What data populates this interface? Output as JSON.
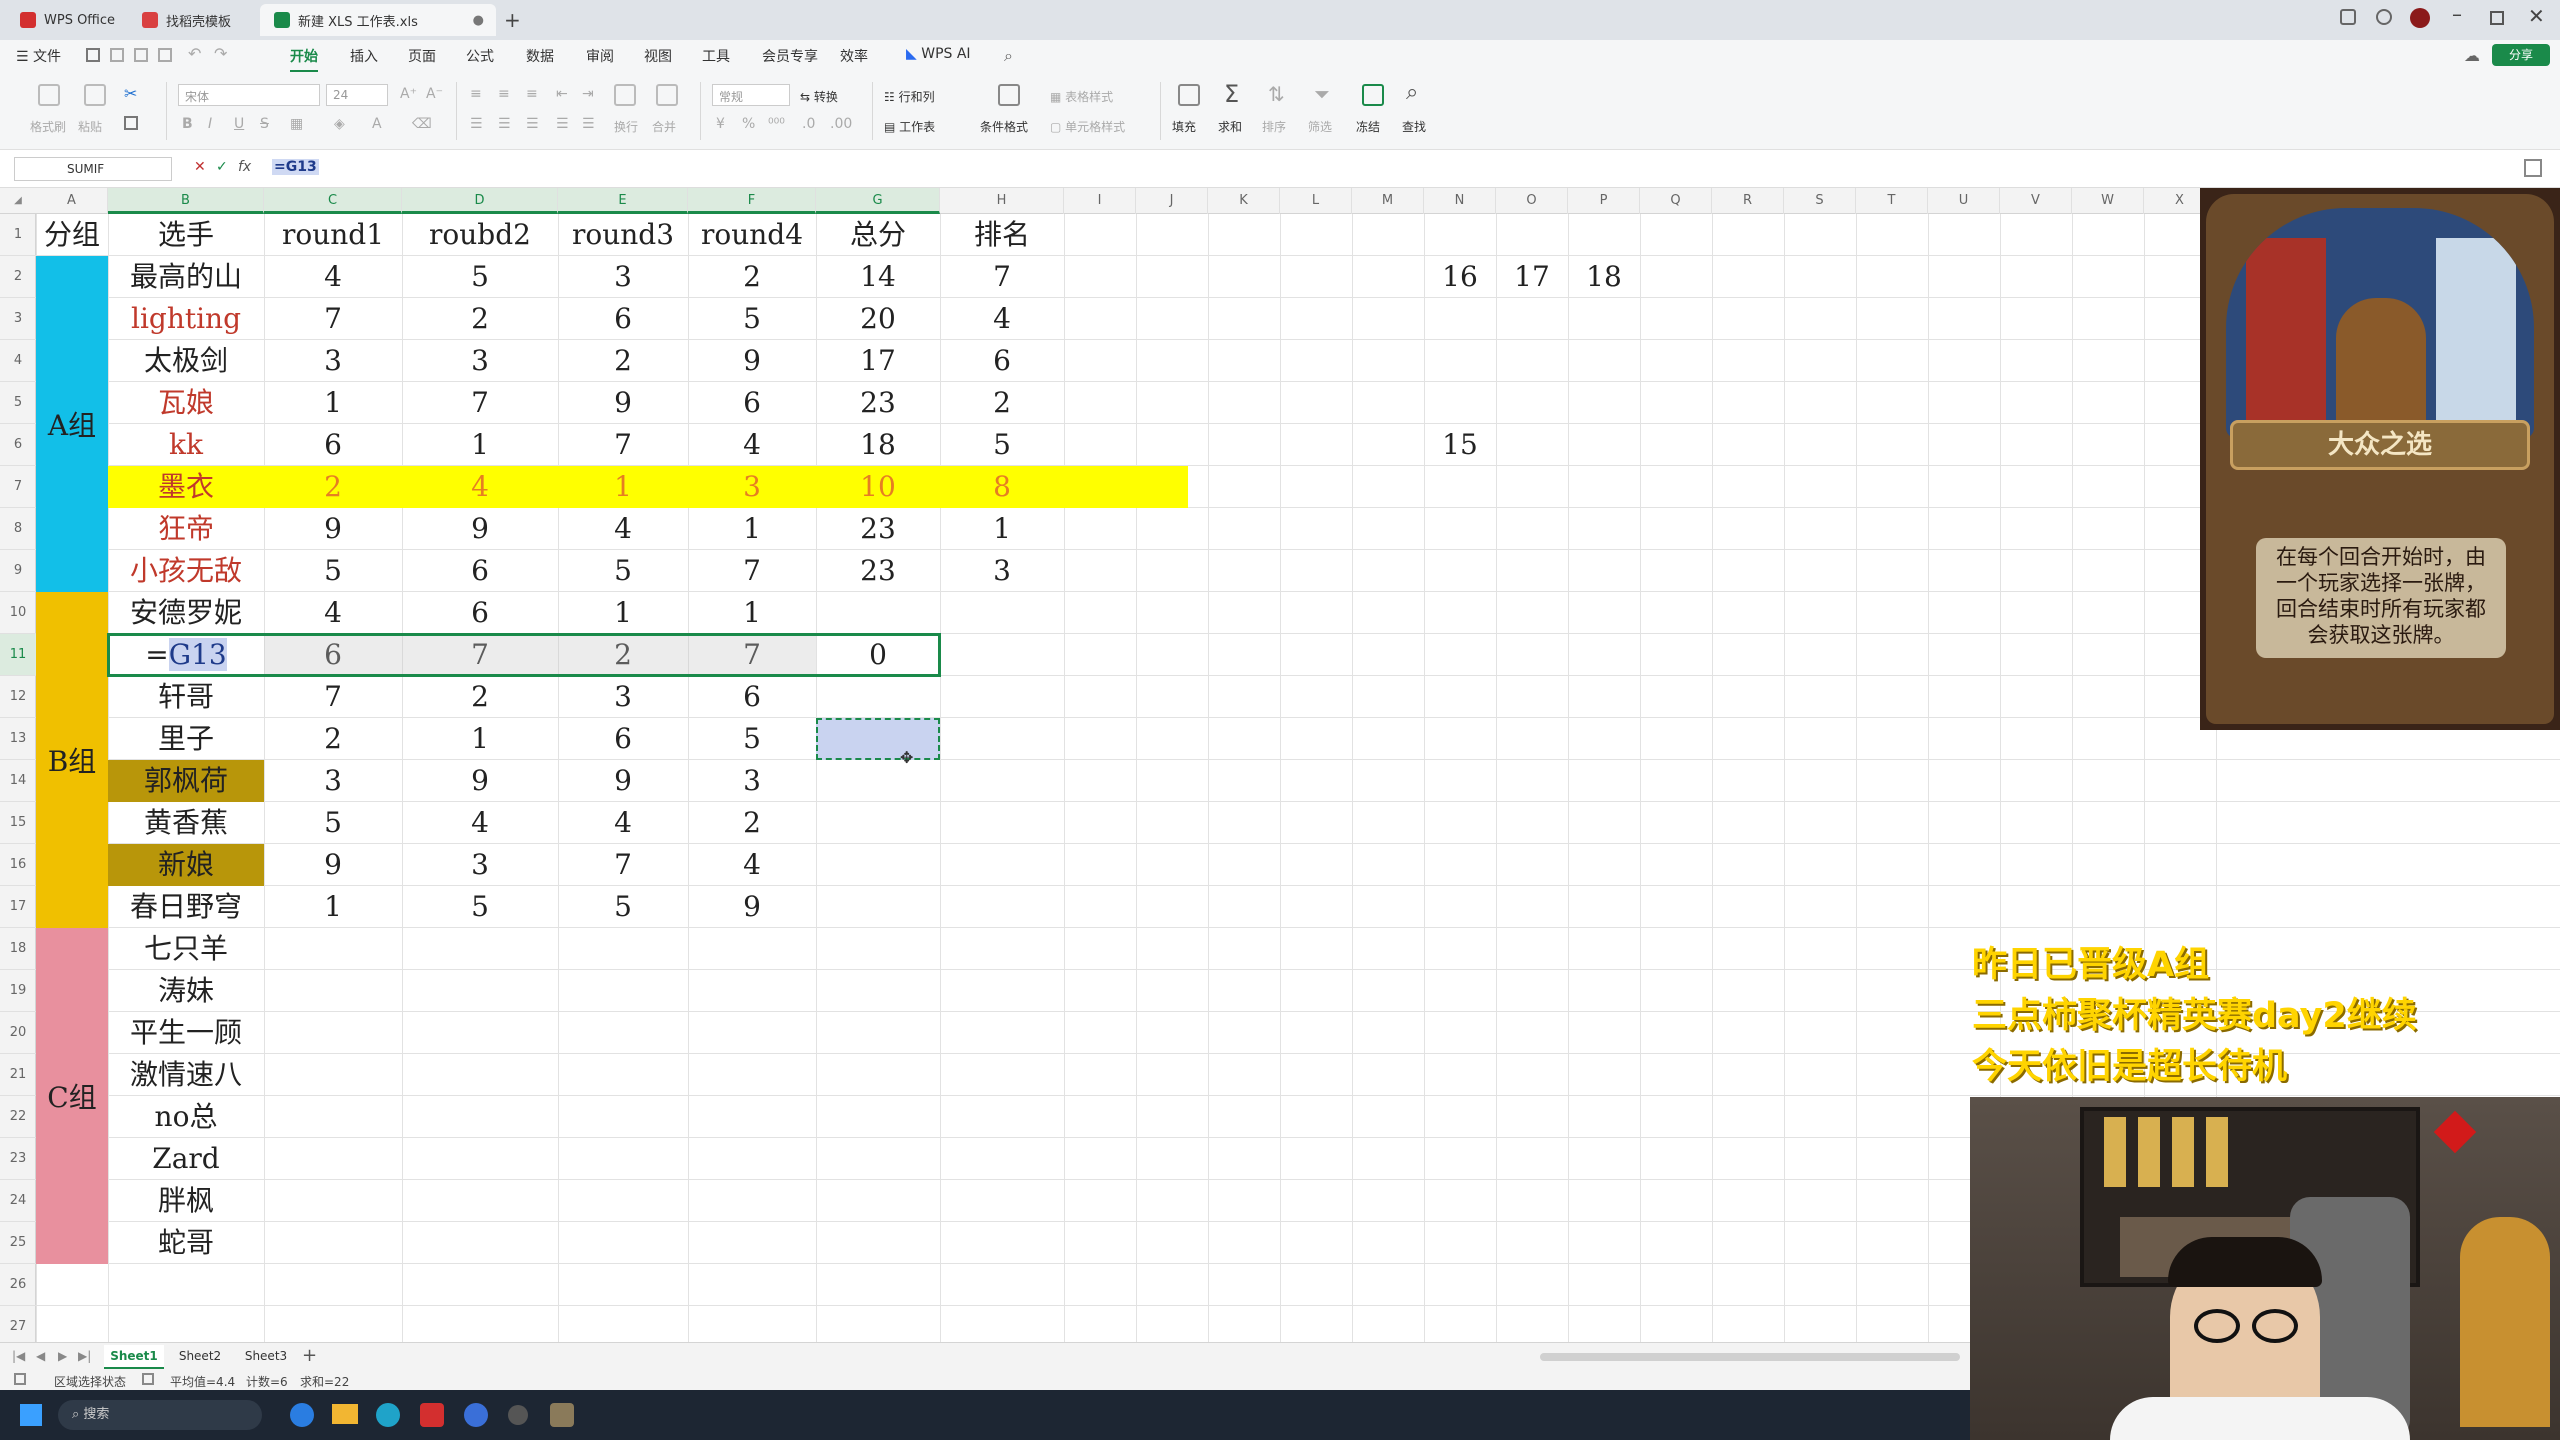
{
  "titlebar": {
    "tabs": [
      {
        "label": "WPS Office"
      },
      {
        "label": "找稻壳模板"
      },
      {
        "label": "新建 XLS 工作表.xls"
      }
    ]
  },
  "menubar": {
    "file": "文件",
    "items": [
      "开始",
      "插入",
      "页面",
      "公式",
      "数据",
      "审阅",
      "视图",
      "工具",
      "会员专享",
      "效率"
    ],
    "wps_ai": "WPS AI",
    "share": "分享"
  },
  "ribbon": {
    "format_painter": "格式刷",
    "paste": "粘贴",
    "font_name": "宋体",
    "font_size": "24",
    "number_format": "常规",
    "convert": "转换",
    "rows_cols": "行和列",
    "table_style": "表格样式",
    "worksheet": "工作表",
    "cond_format": "条件格式",
    "cell_style": "单元格样式",
    "wrap": "换行",
    "merge": "合并",
    "fill": "填充",
    "sum": "求和",
    "sort": "排序",
    "filter": "筛选",
    "freeze": "冻结",
    "find": "查找"
  },
  "formulabar": {
    "namebox": "SUMIF",
    "cancel": "✕",
    "confirm": "✓",
    "fx": "fx",
    "formula": "=G13"
  },
  "columns": [
    "A",
    "B",
    "C",
    "D",
    "E",
    "F",
    "G",
    "H",
    "I",
    "J",
    "K",
    "L",
    "M",
    "N",
    "O",
    "P",
    "Q",
    "R",
    "S",
    "T",
    "U",
    "V",
    "W",
    "X"
  ],
  "rows": [
    "1",
    "2",
    "3",
    "4",
    "5",
    "6",
    "7",
    "8",
    "9",
    "10",
    "11",
    "12",
    "13",
    "14",
    "15",
    "16",
    "17",
    "18",
    "19",
    "20",
    "21",
    "22",
    "23",
    "24",
    "25",
    "26",
    "27"
  ],
  "header_row": [
    "分组",
    "选手",
    "round1",
    "roubd2",
    "round3",
    "round4",
    "总分",
    "排名"
  ],
  "groups": [
    {
      "label": "A组",
      "color": "#12bfe8"
    },
    {
      "label": "B组",
      "color": "#f0c000"
    },
    {
      "label": "C组",
      "color": "#e8909e"
    }
  ],
  "players": [
    {
      "name": "最高的山",
      "r1": "4",
      "r2": "5",
      "r3": "3",
      "r4": "2",
      "total": "14",
      "rank": "7"
    },
    {
      "name": "lighting",
      "r1": "7",
      "r2": "2",
      "r3": "6",
      "r4": "5",
      "total": "20",
      "rank": "4"
    },
    {
      "name": "太极剑",
      "r1": "3",
      "r2": "3",
      "r3": "2",
      "r4": "9",
      "total": "17",
      "rank": "6"
    },
    {
      "name": "瓦娘",
      "r1": "1",
      "r2": "7",
      "r3": "9",
      "r4": "6",
      "total": "23",
      "rank": "2"
    },
    {
      "name": "kk",
      "r1": "6",
      "r2": "1",
      "r3": "7",
      "r4": "4",
      "total": "18",
      "rank": "5"
    },
    {
      "name": "墨衣",
      "r1": "2",
      "r2": "4",
      "r3": "1",
      "r4": "3",
      "total": "10",
      "rank": "8"
    },
    {
      "name": "狂帝",
      "r1": "9",
      "r2": "9",
      "r3": "4",
      "r4": "1",
      "total": "23",
      "rank": "1"
    },
    {
      "name": "小孩无敌",
      "r1": "5",
      "r2": "6",
      "r3": "5",
      "r4": "7",
      "total": "23",
      "rank": "3"
    },
    {
      "name": "安德罗妮",
      "r1": "4",
      "r2": "6",
      "r3": "1",
      "r4": "1",
      "total": "",
      "rank": ""
    },
    {
      "name": "=G13",
      "r1": "6",
      "r2": "7",
      "r3": "2",
      "r4": "7",
      "total": "0",
      "rank": ""
    },
    {
      "name": "轩哥",
      "r1": "7",
      "r2": "2",
      "r3": "3",
      "r4": "6",
      "total": "",
      "rank": ""
    },
    {
      "name": "里子",
      "r1": "2",
      "r2": "1",
      "r3": "6",
      "r4": "5",
      "total": "",
      "rank": ""
    },
    {
      "name": "郭枫荷",
      "r1": "3",
      "r2": "9",
      "r3": "9",
      "r4": "3",
      "total": "",
      "rank": ""
    },
    {
      "name": "黄香蕉",
      "r1": "5",
      "r2": "4",
      "r3": "4",
      "r4": "2",
      "total": "",
      "rank": ""
    },
    {
      "name": "新娘",
      "r1": "9",
      "r2": "3",
      "r3": "7",
      "r4": "4",
      "total": "",
      "rank": ""
    },
    {
      "name": "春日野穹",
      "r1": "1",
      "r2": "5",
      "r3": "5",
      "r4": "9",
      "total": "",
      "rank": ""
    },
    {
      "name": "七只羊"
    },
    {
      "name": "涛妹"
    },
    {
      "name": "平生一顾"
    },
    {
      "name": "激情速八"
    },
    {
      "name": "no总"
    },
    {
      "name": "Zard"
    },
    {
      "name": "胖枫"
    },
    {
      "name": "蛇哥"
    }
  ],
  "side_values": {
    "n2": "16",
    "o2": "17",
    "p2": "18",
    "n6": "15"
  },
  "sheets": [
    "Sheet1",
    "Sheet2",
    "Sheet3"
  ],
  "statusbar": {
    "mode": "区域选择状态",
    "avg": "平均值=4.4",
    "count": "计数=6",
    "sum": "求和=22"
  },
  "taskbar": {
    "search_placeholder": "搜索"
  },
  "card": {
    "title": "大众之选",
    "text": "在每个回合开始时，由一个玩家选择一张牌，回合结束时所有玩家都会获取这张牌。"
  },
  "overlay": {
    "line1": "昨日已晋级A组",
    "line2": "三点柿聚杯精英赛day2继续",
    "line3": "今天依旧是超长待机"
  },
  "colors": {
    "accent_green": "#1a8a4a",
    "highlight_yellow": "#ffff00",
    "dark_gold": "#b8960a",
    "red_text": "#c0392b"
  }
}
